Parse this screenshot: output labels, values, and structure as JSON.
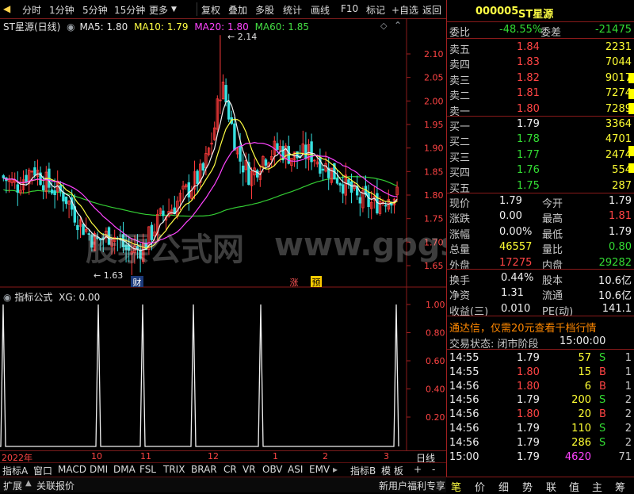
{
  "toolbar": {
    "items": [
      "分时",
      "1分钟",
      "5分钟",
      "15分钟",
      "更多",
      "复权",
      "叠加",
      "多股",
      "统计",
      "画线",
      "F10",
      "标记",
      "+自选",
      "返回"
    ]
  },
  "chart": {
    "title": "ST星源(日线)",
    "ma5_label": "MA5: 1.80",
    "ma10_label": "MA10: 1.79",
    "ma20_label": "MA20: 1.80",
    "ma60_label": "MA60: 1.85",
    "high_annotation": "2.14",
    "low_annotation": "1.63",
    "markers": [
      "财",
      "涨",
      "预"
    ],
    "price_ticks": [
      "2.10",
      "2.05",
      "2.00",
      "1.95",
      "1.90",
      "1.85",
      "1.80",
      "1.75",
      "1.70",
      "1.65"
    ],
    "indicator_title": "指标公式",
    "indicator_value": "XG: 0.00",
    "indicator_ticks": [
      "1.00",
      "0.80",
      "0.60",
      "0.40",
      "0.20"
    ],
    "date_labels": [
      "2022年",
      "10",
      "11",
      "12",
      "1",
      "2",
      "3"
    ],
    "period_label": "日线",
    "watermark_cn": "股票公式网",
    "watermark_url": "www.gpgs.cn"
  },
  "chart_data": {
    "type": "candlestick",
    "ylim": [
      1.61,
      2.17
    ],
    "indicator_ylim": [
      0,
      1.1
    ],
    "ohlc_sample": {
      "high": 2.14,
      "low": 1.63,
      "last_close": 1.79
    },
    "indicator_spikes": [
      1,
      1,
      1,
      1,
      1,
      1
    ]
  },
  "stock": {
    "code": "000005",
    "name": "ST星源"
  },
  "book": {
    "weibi_label": "委比",
    "weibi": "-48.55%",
    "weicha_label": "委差",
    "weicha": "-21475",
    "asks": [
      {
        "label": "卖五",
        "price": "1.84",
        "vol": "2231"
      },
      {
        "label": "卖四",
        "price": "1.83",
        "vol": "7044"
      },
      {
        "label": "卖三",
        "price": "1.82",
        "vol": "9017"
      },
      {
        "label": "卖二",
        "price": "1.81",
        "vol": "7274"
      },
      {
        "label": "卖一",
        "price": "1.80",
        "vol": "7289"
      }
    ],
    "bids": [
      {
        "label": "买一",
        "price": "1.79",
        "vol": "3364"
      },
      {
        "label": "买二",
        "price": "1.78",
        "vol": "4701"
      },
      {
        "label": "买三",
        "price": "1.77",
        "vol": "2474"
      },
      {
        "label": "买四",
        "price": "1.76",
        "vol": "554"
      },
      {
        "label": "买五",
        "price": "1.75",
        "vol": "287"
      }
    ]
  },
  "quote": [
    {
      "l1": "现价",
      "v1": "1.79",
      "l2": "今开",
      "v2": "1.79",
      "c2": "white"
    },
    {
      "l1": "涨跌",
      "v1": "0.00",
      "l2": "最高",
      "v2": "1.81",
      "c2": "red"
    },
    {
      "l1": "涨幅",
      "v1": "0.00%",
      "l2": "最低",
      "v2": "1.79",
      "c2": "white"
    },
    {
      "l1": "总量",
      "v1": "46557",
      "l2": "量比",
      "v2": "0.80",
      "c2": "green"
    },
    {
      "l1": "外盘",
      "v1": "17275",
      "l2": "内盘",
      "v2": "29282",
      "c2": "green"
    }
  ],
  "fin": [
    {
      "l1": "换手",
      "v1": "0.44%",
      "l2": "股本",
      "v2": "10.6亿"
    },
    {
      "l1": "净资",
      "v1": "1.31",
      "l2": "流通",
      "v2": "10.6亿"
    },
    {
      "l1": "收益(三)",
      "v1": "0.010",
      "l2": "PE(动)",
      "v2": "141.1"
    }
  ],
  "promo": "通达信，仅需20元查看千档行情",
  "trade_status_label": "交易状态: 闭市阶段",
  "trade_status_time": "15:00:00",
  "ticks": [
    {
      "t": "14:55",
      "p": "1.79",
      "pc": "white",
      "v": "57",
      "s": "S",
      "n": "1"
    },
    {
      "t": "14:55",
      "p": "1.80",
      "pc": "red",
      "v": "15",
      "s": "B",
      "n": "1"
    },
    {
      "t": "14:56",
      "p": "1.80",
      "pc": "red",
      "v": "6",
      "s": "B",
      "n": "1"
    },
    {
      "t": "14:56",
      "p": "1.79",
      "pc": "white",
      "v": "200",
      "s": "S",
      "n": "2"
    },
    {
      "t": "14:56",
      "p": "1.80",
      "pc": "red",
      "v": "20",
      "s": "B",
      "n": "2"
    },
    {
      "t": "14:56",
      "p": "1.79",
      "pc": "white",
      "v": "110",
      "s": "S",
      "n": "2"
    },
    {
      "t": "14:56",
      "p": "1.79",
      "pc": "white",
      "v": "286",
      "s": "S",
      "n": "2"
    },
    {
      "t": "15:00",
      "p": "1.79",
      "pc": "white",
      "v": "4620",
      "s": "",
      "n": "71"
    }
  ],
  "bottom_tabs": [
    "指标A",
    "窗口",
    "MACD",
    "DMI",
    "DMA",
    "FSL",
    "TRIX",
    "BRAR",
    "CR",
    "VR",
    "OBV",
    "ASI",
    "EMV",
    "指标B",
    "模 板",
    "+",
    "-"
  ],
  "status_left": [
    "扩展",
    "关联报价"
  ],
  "status_right": "新用户福利专享",
  "right_tabs": [
    "笔",
    "价",
    "细",
    "势",
    "联",
    "值",
    "主",
    "筹"
  ]
}
